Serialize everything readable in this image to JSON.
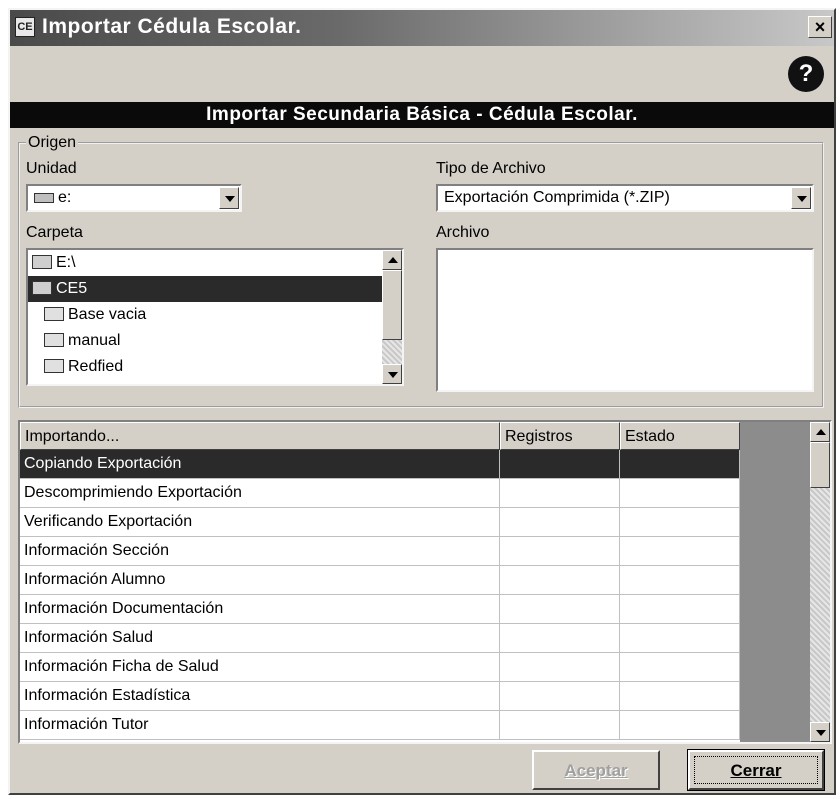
{
  "window": {
    "title": "Importar Cédula Escolar.",
    "close_glyph": "×",
    "help_glyph": "?",
    "banner": "Importar Secundaria Básica - Cédula Escolar."
  },
  "origen": {
    "legend": "Origen",
    "unidad_label": "Unidad",
    "unidad_value": "e:",
    "tipo_label": "Tipo de Archivo",
    "tipo_value": "Exportación Comprimida (*.ZIP)",
    "carpeta_label": "Carpeta",
    "archivo_label": "Archivo",
    "folders": [
      {
        "name": "E:\\",
        "selected": false
      },
      {
        "name": "CE5",
        "selected": true
      },
      {
        "name": "Base vacia",
        "selected": false
      },
      {
        "name": "manual",
        "selected": false
      },
      {
        "name": "Redfied",
        "selected": false
      }
    ]
  },
  "grid": {
    "columns": [
      "Importando...",
      "Registros",
      "Estado"
    ],
    "rows": [
      {
        "task": "Copiando Exportación",
        "registros": "",
        "estado": "",
        "selected": true
      },
      {
        "task": "Descomprimiendo Exportación",
        "registros": "",
        "estado": "",
        "selected": false
      },
      {
        "task": "Verificando Exportación",
        "registros": "",
        "estado": "",
        "selected": false
      },
      {
        "task": "Información Sección",
        "registros": "",
        "estado": "",
        "selected": false
      },
      {
        "task": "Información Alumno",
        "registros": "",
        "estado": "",
        "selected": false
      },
      {
        "task": "Información Documentación",
        "registros": "",
        "estado": "",
        "selected": false
      },
      {
        "task": "Información Salud",
        "registros": "",
        "estado": "",
        "selected": false
      },
      {
        "task": "Información Ficha de Salud",
        "registros": "",
        "estado": "",
        "selected": false
      },
      {
        "task": "Información Estadística",
        "registros": "",
        "estado": "",
        "selected": false
      },
      {
        "task": "Información Tutor",
        "registros": "",
        "estado": "",
        "selected": false
      }
    ]
  },
  "buttons": {
    "aceptar": "Aceptar",
    "cerrar": "Cerrar"
  }
}
